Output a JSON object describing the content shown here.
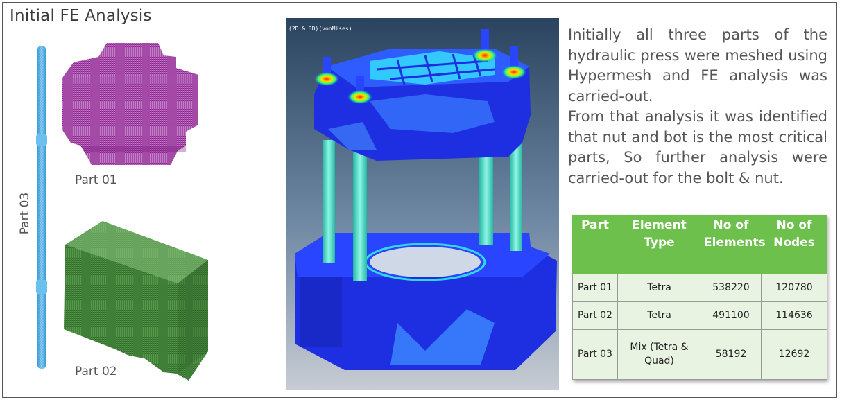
{
  "slide": {
    "title": "Initial FE Analysis",
    "labels": {
      "part01": "Part 01",
      "part02": "Part 02",
      "part03": "Part 03"
    },
    "viewer_label": "(2D & 3D)(vonMises)",
    "description": [
      "Initially all three parts of the hydraulic press were meshed using Hypermesh and FE analysis was carried-out.",
      "From that analysis it was identified that nut and bot is the most critical parts, So further analysis were carried-out for the bolt & nut."
    ],
    "colors": {
      "part01_mesh": "#8e1f8e",
      "part02_mesh": "#2f7d2a",
      "part03_rod": "#5bb5e8",
      "fe_blue": "#1d2fe0",
      "fe_cyan": "#3ee0d0",
      "table_header": "#6ec04c",
      "table_body": "#e9f3e2"
    }
  },
  "table": {
    "headers": [
      "Part",
      "Element Type",
      "No of Elements",
      "No of Nodes"
    ],
    "rows": [
      {
        "part": "Part 01",
        "type": "Tetra",
        "elements": "538220",
        "nodes": "120780"
      },
      {
        "part": "Part 02",
        "type": "Tetra",
        "elements": "491100",
        "nodes": "114636"
      },
      {
        "part": "Part 03",
        "type": "Mix (Tetra & Quad)",
        "elements": "58192",
        "nodes": "12692"
      }
    ]
  }
}
